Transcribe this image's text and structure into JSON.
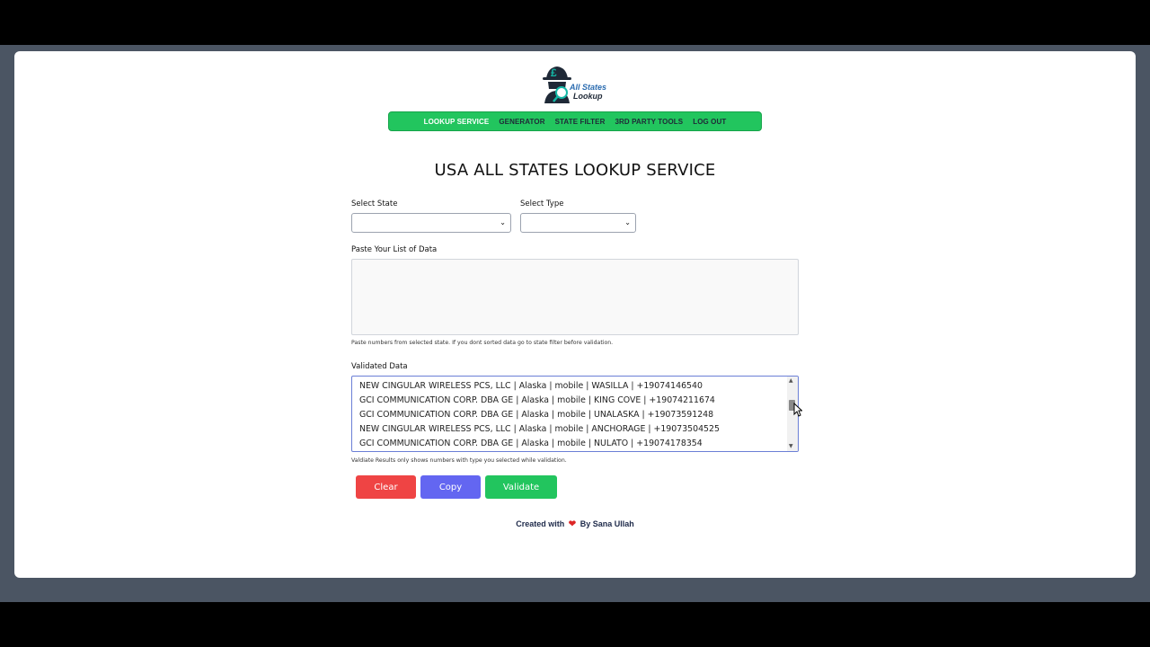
{
  "brand": {
    "line1": "All States",
    "line2": "Lookup"
  },
  "nav": {
    "items": [
      {
        "label": "LOOKUP SERVICE",
        "active": true
      },
      {
        "label": "GENERATOR"
      },
      {
        "label": "STATE FILTER"
      },
      {
        "label": "3RD PARTY TOOLS"
      },
      {
        "label": "LOG OUT"
      }
    ]
  },
  "page": {
    "title": "USA ALL STATES LOOKUP SERVICE"
  },
  "form": {
    "state_label": "Select State",
    "state_value": "",
    "type_label": "Select Type",
    "type_value": "",
    "paste_label": "Paste Your List of Data",
    "paste_value": "",
    "paste_hint": "Paste numbers from selected state. If you dont sorted data go to state filter before validation.",
    "validated_label": "Validated Data",
    "validated_lines": [
      "NEW CINGULAR WIRELESS PCS, LLC | Alaska | mobile | WASILLA | +19074146540",
      "GCI COMMUNICATION CORP. DBA GE | Alaska | mobile | KING COVE | +19074211674",
      "GCI COMMUNICATION CORP. DBA GE | Alaska | mobile | UNALASKA | +19073591248",
      "NEW CINGULAR WIRELESS PCS, LLC | Alaska | mobile | ANCHORAGE | +19073504525",
      "GCI COMMUNICATION CORP. DBA GE | Alaska | mobile | NULATO | +19074178354"
    ],
    "validated_hint": "Valdiate Results only shows numbers with type you selected while validation."
  },
  "buttons": {
    "clear": "Clear",
    "copy": "Copy",
    "validate": "Validate"
  },
  "footer": {
    "prefix": "Created with",
    "heart": "❤",
    "suffix": "By Sana Ullah"
  },
  "colors": {
    "nav": "#22c55e",
    "clear": "#ef4444",
    "copy": "#6366f1",
    "validate": "#22c55e",
    "heart": "#dc2626"
  },
  "icons": {
    "logo": "detective-magnifier-logo",
    "select_chevron": "chevron-down-icon",
    "heart": "heart-icon"
  }
}
